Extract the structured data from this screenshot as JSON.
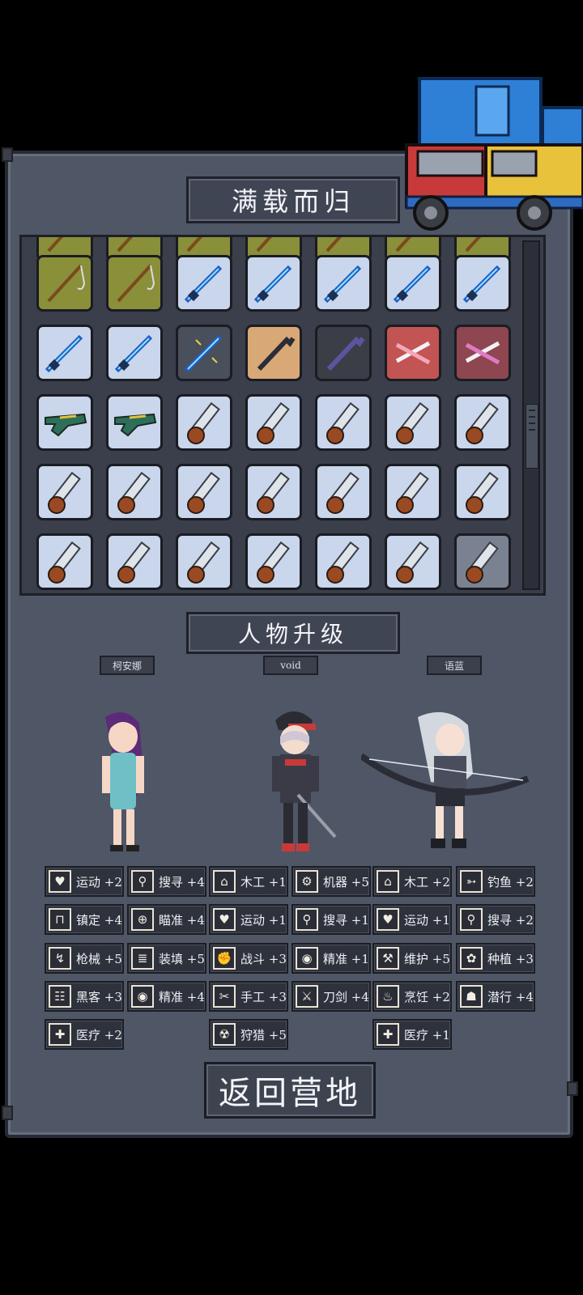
{
  "header": {
    "title": "满载而归"
  },
  "inventory": {
    "rows": [
      [
        "partial",
        "partial",
        "partial",
        "partial",
        "partial",
        "partial",
        "partial"
      ],
      [
        "fishing-rod",
        "fishing-rod",
        "ice-spear",
        "ice-spear",
        "ice-spear",
        "ice-spear",
        "ice-spear"
      ],
      [
        "ice-spear",
        "ice-spear",
        "ice-spear-dark",
        "crowbar",
        "crowbar-dark",
        "twin-blade",
        "twin-blade-dark"
      ],
      [
        "plasma-gun",
        "plasma-gun",
        "chainsaw",
        "chainsaw",
        "chainsaw",
        "chainsaw",
        "chainsaw"
      ],
      [
        "chainsaw",
        "chainsaw",
        "chainsaw",
        "chainsaw",
        "chainsaw",
        "chainsaw",
        "chainsaw"
      ],
      [
        "chainsaw",
        "chainsaw",
        "chainsaw",
        "chainsaw",
        "chainsaw",
        "chainsaw",
        "chainsaw-dim"
      ]
    ]
  },
  "upgrade": {
    "title": "人物升级",
    "characters": [
      {
        "name": "柯安娜"
      },
      {
        "name": "void"
      },
      {
        "name": "语蓝"
      }
    ],
    "skills": [
      [
        {
          "icon": "heart-icon",
          "label": "运动 +2"
        },
        {
          "icon": "lock-icon",
          "label": "镇定 +4"
        },
        {
          "icon": "gun-icon",
          "label": "枪械 +5"
        },
        {
          "icon": "hacker-icon",
          "label": "黑客 +3"
        },
        {
          "icon": "medkit-icon",
          "label": "医疗 +2"
        }
      ],
      [
        {
          "icon": "magnifier-icon",
          "label": "搜寻 +4"
        },
        {
          "icon": "crosshair-icon",
          "label": "瞄准 +4"
        },
        {
          "icon": "ammo-icon",
          "label": "装填 +5"
        },
        {
          "icon": "eye-icon",
          "label": "精准 +4"
        }
      ],
      [
        {
          "icon": "house-icon",
          "label": "木工 +1"
        },
        {
          "icon": "heart-icon",
          "label": "运动 +1"
        },
        {
          "icon": "fist-icon",
          "label": "战斗 +3"
        },
        {
          "icon": "scissors-icon",
          "label": "手工 +3"
        },
        {
          "icon": "radiation-icon",
          "label": "狩猎 +5"
        }
      ],
      [
        {
          "icon": "gear-icon",
          "label": "机器 +5"
        },
        {
          "icon": "magnifier-icon",
          "label": "搜寻 +1"
        },
        {
          "icon": "eye-icon",
          "label": "精准 +1"
        },
        {
          "icon": "sword-icon",
          "label": "刀剑 +4"
        }
      ],
      [
        {
          "icon": "house-icon",
          "label": "木工 +2"
        },
        {
          "icon": "heart-icon",
          "label": "运动 +1"
        },
        {
          "icon": "wrench-icon",
          "label": "维护 +5"
        },
        {
          "icon": "cooking-icon",
          "label": "烹饪 +2"
        },
        {
          "icon": "medkit-icon",
          "label": "医疗 +1"
        }
      ],
      [
        {
          "icon": "fish-icon",
          "label": "钓鱼 +2"
        },
        {
          "icon": "magnifier-icon",
          "label": "搜寻 +2"
        },
        {
          "icon": "plant-icon",
          "label": "种植 +3"
        },
        {
          "icon": "sneak-icon",
          "label": "潜行 +4"
        }
      ]
    ]
  },
  "footer": {
    "return_label": "返回营地"
  },
  "colors": {
    "panel": "#4f5666",
    "slot_ice": "#c9d6ec",
    "slot_olive": "#8a8f3a",
    "slot_tan": "#d9a877",
    "slot_red": "#c25454"
  }
}
